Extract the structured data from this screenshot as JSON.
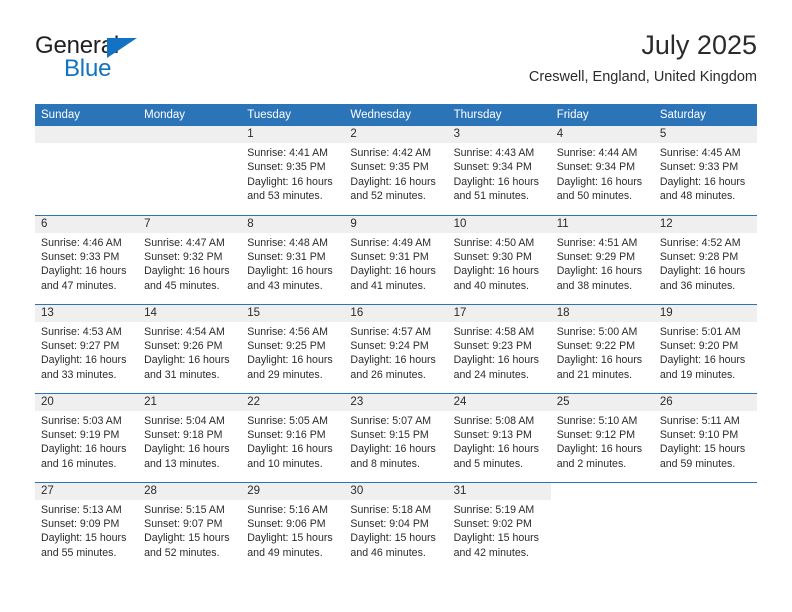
{
  "brand": {
    "name_top": "General",
    "name_bottom": "Blue"
  },
  "header": {
    "month_title": "July 2025",
    "location": "Creswell, England, United Kingdom"
  },
  "colors": {
    "header_blue": "#2c74b8",
    "brand_blue": "#1273c4",
    "daynum_band": "#efefef",
    "text": "#2b2b2b"
  },
  "calendar": {
    "weekday_headers": [
      "Sunday",
      "Monday",
      "Tuesday",
      "Wednesday",
      "Thursday",
      "Friday",
      "Saturday"
    ],
    "weeks": [
      [
        {
          "day": "",
          "sunrise": "",
          "sunset": "",
          "daylight_1": "",
          "daylight_2": ""
        },
        {
          "day": "",
          "sunrise": "",
          "sunset": "",
          "daylight_1": "",
          "daylight_2": ""
        },
        {
          "day": "1",
          "sunrise": "Sunrise: 4:41 AM",
          "sunset": "Sunset: 9:35 PM",
          "daylight_1": "Daylight: 16 hours",
          "daylight_2": "and 53 minutes."
        },
        {
          "day": "2",
          "sunrise": "Sunrise: 4:42 AM",
          "sunset": "Sunset: 9:35 PM",
          "daylight_1": "Daylight: 16 hours",
          "daylight_2": "and 52 minutes."
        },
        {
          "day": "3",
          "sunrise": "Sunrise: 4:43 AM",
          "sunset": "Sunset: 9:34 PM",
          "daylight_1": "Daylight: 16 hours",
          "daylight_2": "and 51 minutes."
        },
        {
          "day": "4",
          "sunrise": "Sunrise: 4:44 AM",
          "sunset": "Sunset: 9:34 PM",
          "daylight_1": "Daylight: 16 hours",
          "daylight_2": "and 50 minutes."
        },
        {
          "day": "5",
          "sunrise": "Sunrise: 4:45 AM",
          "sunset": "Sunset: 9:33 PM",
          "daylight_1": "Daylight: 16 hours",
          "daylight_2": "and 48 minutes."
        }
      ],
      [
        {
          "day": "6",
          "sunrise": "Sunrise: 4:46 AM",
          "sunset": "Sunset: 9:33 PM",
          "daylight_1": "Daylight: 16 hours",
          "daylight_2": "and 47 minutes."
        },
        {
          "day": "7",
          "sunrise": "Sunrise: 4:47 AM",
          "sunset": "Sunset: 9:32 PM",
          "daylight_1": "Daylight: 16 hours",
          "daylight_2": "and 45 minutes."
        },
        {
          "day": "8",
          "sunrise": "Sunrise: 4:48 AM",
          "sunset": "Sunset: 9:31 PM",
          "daylight_1": "Daylight: 16 hours",
          "daylight_2": "and 43 minutes."
        },
        {
          "day": "9",
          "sunrise": "Sunrise: 4:49 AM",
          "sunset": "Sunset: 9:31 PM",
          "daylight_1": "Daylight: 16 hours",
          "daylight_2": "and 41 minutes."
        },
        {
          "day": "10",
          "sunrise": "Sunrise: 4:50 AM",
          "sunset": "Sunset: 9:30 PM",
          "daylight_1": "Daylight: 16 hours",
          "daylight_2": "and 40 minutes."
        },
        {
          "day": "11",
          "sunrise": "Sunrise: 4:51 AM",
          "sunset": "Sunset: 9:29 PM",
          "daylight_1": "Daylight: 16 hours",
          "daylight_2": "and 38 minutes."
        },
        {
          "day": "12",
          "sunrise": "Sunrise: 4:52 AM",
          "sunset": "Sunset: 9:28 PM",
          "daylight_1": "Daylight: 16 hours",
          "daylight_2": "and 36 minutes."
        }
      ],
      [
        {
          "day": "13",
          "sunrise": "Sunrise: 4:53 AM",
          "sunset": "Sunset: 9:27 PM",
          "daylight_1": "Daylight: 16 hours",
          "daylight_2": "and 33 minutes."
        },
        {
          "day": "14",
          "sunrise": "Sunrise: 4:54 AM",
          "sunset": "Sunset: 9:26 PM",
          "daylight_1": "Daylight: 16 hours",
          "daylight_2": "and 31 minutes."
        },
        {
          "day": "15",
          "sunrise": "Sunrise: 4:56 AM",
          "sunset": "Sunset: 9:25 PM",
          "daylight_1": "Daylight: 16 hours",
          "daylight_2": "and 29 minutes."
        },
        {
          "day": "16",
          "sunrise": "Sunrise: 4:57 AM",
          "sunset": "Sunset: 9:24 PM",
          "daylight_1": "Daylight: 16 hours",
          "daylight_2": "and 26 minutes."
        },
        {
          "day": "17",
          "sunrise": "Sunrise: 4:58 AM",
          "sunset": "Sunset: 9:23 PM",
          "daylight_1": "Daylight: 16 hours",
          "daylight_2": "and 24 minutes."
        },
        {
          "day": "18",
          "sunrise": "Sunrise: 5:00 AM",
          "sunset": "Sunset: 9:22 PM",
          "daylight_1": "Daylight: 16 hours",
          "daylight_2": "and 21 minutes."
        },
        {
          "day": "19",
          "sunrise": "Sunrise: 5:01 AM",
          "sunset": "Sunset: 9:20 PM",
          "daylight_1": "Daylight: 16 hours",
          "daylight_2": "and 19 minutes."
        }
      ],
      [
        {
          "day": "20",
          "sunrise": "Sunrise: 5:03 AM",
          "sunset": "Sunset: 9:19 PM",
          "daylight_1": "Daylight: 16 hours",
          "daylight_2": "and 16 minutes."
        },
        {
          "day": "21",
          "sunrise": "Sunrise: 5:04 AM",
          "sunset": "Sunset: 9:18 PM",
          "daylight_1": "Daylight: 16 hours",
          "daylight_2": "and 13 minutes."
        },
        {
          "day": "22",
          "sunrise": "Sunrise: 5:05 AM",
          "sunset": "Sunset: 9:16 PM",
          "daylight_1": "Daylight: 16 hours",
          "daylight_2": "and 10 minutes."
        },
        {
          "day": "23",
          "sunrise": "Sunrise: 5:07 AM",
          "sunset": "Sunset: 9:15 PM",
          "daylight_1": "Daylight: 16 hours",
          "daylight_2": "and 8 minutes."
        },
        {
          "day": "24",
          "sunrise": "Sunrise: 5:08 AM",
          "sunset": "Sunset: 9:13 PM",
          "daylight_1": "Daylight: 16 hours",
          "daylight_2": "and 5 minutes."
        },
        {
          "day": "25",
          "sunrise": "Sunrise: 5:10 AM",
          "sunset": "Sunset: 9:12 PM",
          "daylight_1": "Daylight: 16 hours",
          "daylight_2": "and 2 minutes."
        },
        {
          "day": "26",
          "sunrise": "Sunrise: 5:11 AM",
          "sunset": "Sunset: 9:10 PM",
          "daylight_1": "Daylight: 15 hours",
          "daylight_2": "and 59 minutes."
        }
      ],
      [
        {
          "day": "27",
          "sunrise": "Sunrise: 5:13 AM",
          "sunset": "Sunset: 9:09 PM",
          "daylight_1": "Daylight: 15 hours",
          "daylight_2": "and 55 minutes."
        },
        {
          "day": "28",
          "sunrise": "Sunrise: 5:15 AM",
          "sunset": "Sunset: 9:07 PM",
          "daylight_1": "Daylight: 15 hours",
          "daylight_2": "and 52 minutes."
        },
        {
          "day": "29",
          "sunrise": "Sunrise: 5:16 AM",
          "sunset": "Sunset: 9:06 PM",
          "daylight_1": "Daylight: 15 hours",
          "daylight_2": "and 49 minutes."
        },
        {
          "day": "30",
          "sunrise": "Sunrise: 5:18 AM",
          "sunset": "Sunset: 9:04 PM",
          "daylight_1": "Daylight: 15 hours",
          "daylight_2": "and 46 minutes."
        },
        {
          "day": "31",
          "sunrise": "Sunrise: 5:19 AM",
          "sunset": "Sunset: 9:02 PM",
          "daylight_1": "Daylight: 15 hours",
          "daylight_2": "and 42 minutes."
        },
        {
          "day": "",
          "sunrise": "",
          "sunset": "",
          "daylight_1": "",
          "daylight_2": ""
        },
        {
          "day": "",
          "sunrise": "",
          "sunset": "",
          "daylight_1": "",
          "daylight_2": ""
        }
      ]
    ]
  }
}
